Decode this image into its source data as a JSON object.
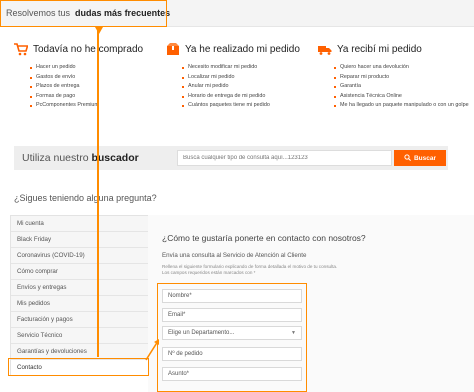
{
  "top": {
    "prefix": "Resolvemos tus",
    "bold": "dudas más frecuentes"
  },
  "sections": [
    {
      "icon": "cart-icon",
      "title": "Todavía no he comprado",
      "items": [
        "Hacer un pedido",
        "Gastos de envío",
        "Plazos de entrega",
        "Formas de pago",
        "PcComponentes Premium"
      ]
    },
    {
      "icon": "box-icon",
      "title": "Ya he realizado mi pedido",
      "items": [
        "Necesito modificar mi pedido",
        "Localizar mi pedido",
        "Anular mi pedido",
        "Horario de entrega de mi pedido",
        "Cuántos paquetes tiene mi pedido"
      ]
    },
    {
      "icon": "truck-icon",
      "title": "Ya recibí mi pedido",
      "items": [
        "Quiero hacer una devolución",
        "Reparar mi producto",
        "Garantía",
        "Asistencia Técnica Online",
        "Me ha llegado un paquete manipulado o con un golpe"
      ]
    }
  ],
  "search": {
    "label_prefix": "Utiliza nuestro",
    "label_bold": "buscador",
    "placeholder": "Busca cualquier tipo de consulta aquí...123123",
    "button": "Buscar"
  },
  "question": "¿Sigues teniendo alguna pregunta?",
  "menu": [
    "Mi cuenta",
    "Black Friday",
    "Coronavirus (COVID-19)",
    "Cómo comprar",
    "Envíos y entregas",
    "Mis pedidos",
    "Facturación y pagos",
    "Servicio Técnico",
    "Garantías y devoluciones",
    "Contacto"
  ],
  "panel": {
    "question": "¿Cómo te gustaría ponerte en contacto con nosotros?",
    "subtitle": "Envía una consulta al Servicio de Atención al Cliente",
    "hint1": "Rellena el siguiente formulario explicando de forma detallada el motivo de tu consulta.",
    "hint2": "Los campos requeridos están marcados con *"
  },
  "form": {
    "name": "Nombre*",
    "email": "Email*",
    "department": "Elige un Departamento...",
    "order": "Nº de pedido",
    "subject": "Asunto*"
  },
  "colors": {
    "accent": "#ff6000",
    "annotation": "#ff8c00"
  }
}
